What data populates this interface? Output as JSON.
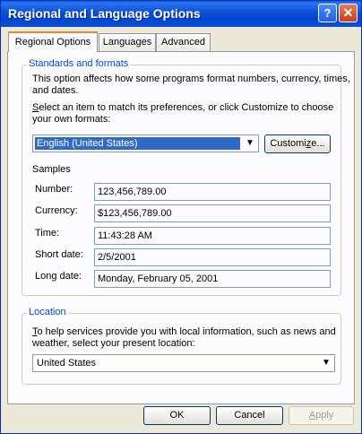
{
  "window": {
    "title": "Regional and Language Options",
    "help_button": "?",
    "close_button": "✕"
  },
  "tabs": [
    {
      "label": "Regional Options"
    },
    {
      "label": "Languages"
    },
    {
      "label": "Advanced"
    }
  ],
  "standards": {
    "legend": "Standards and formats",
    "desc_line1": "This option affects how some programs format numbers, currency, times,",
    "desc_line2": "and dates.",
    "select_line1_key": "S",
    "select_line1_rest": "elect an item to match its preferences, or click Customize to choose",
    "select_line2": "your own formats:",
    "format_selected": "English (United States)",
    "customize_key": "z",
    "customize_pre": "Customi",
    "customize_post": "e...",
    "samples_label": "Samples",
    "samples": [
      {
        "label": "Number:",
        "value": "123,456,789.00"
      },
      {
        "label": "Currency:",
        "value": "$123,456,789.00"
      },
      {
        "label": "Time:",
        "value": "11:43:28 AM"
      },
      {
        "label": "Short date:",
        "value": "2/5/2001"
      },
      {
        "label": "Long date:",
        "value": "Monday, February 05, 2001"
      }
    ]
  },
  "location": {
    "legend": "Location",
    "desc_line1_key": "T",
    "desc_line1_rest": "o help services provide you with local information, such as news and",
    "desc_line2": "weather, select your present location:",
    "selected": "United States"
  },
  "buttons": {
    "ok": "OK",
    "cancel": "Cancel",
    "apply_key": "A",
    "apply_rest": "pply"
  }
}
